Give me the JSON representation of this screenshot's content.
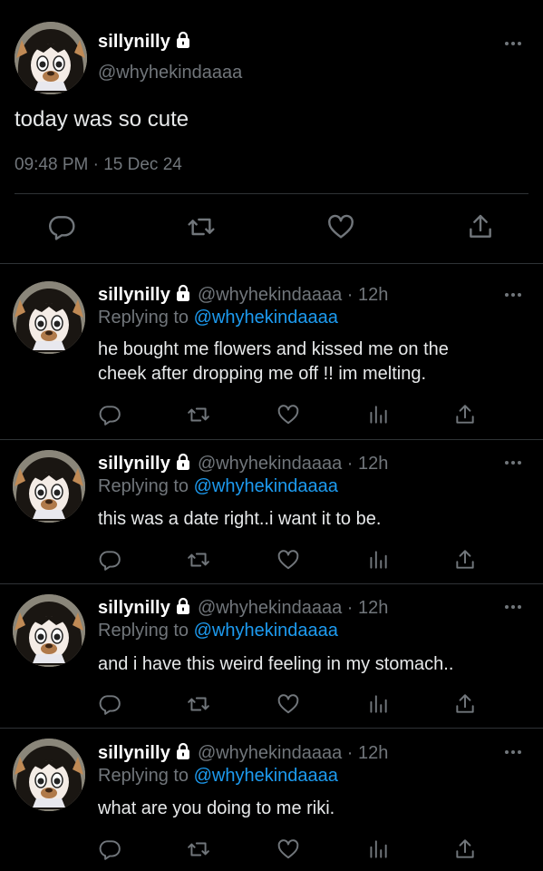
{
  "main_tweet": {
    "display_name": "sillynilly",
    "handle": "@whyhekindaaaa",
    "text": "today was so cute",
    "timestamp": "09:48 PM · 15 Dec 24",
    "protected": true,
    "actions": [
      "reply-icon",
      "retweet-icon",
      "like-icon",
      "share-icon"
    ]
  },
  "replies": [
    {
      "display_name": "sillynilly",
      "handle": "@whyhekindaaaa",
      "time": "· 12h",
      "replying_prefix": "Replying to",
      "replying_to": "@whyhekindaaaa",
      "text_lines": [
        "he bought me flowers and kissed me on the",
        "cheek after dropping me off !! im melting."
      ]
    },
    {
      "display_name": "sillynilly",
      "handle": "@whyhekindaaaa",
      "time": "· 12h",
      "replying_prefix": "Replying to",
      "replying_to": "@whyhekindaaaa",
      "text_lines": [
        "this was a date right..i want it to be."
      ]
    },
    {
      "display_name": "sillynilly",
      "handle": "@whyhekindaaaa",
      "time": "· 12h",
      "replying_prefix": "Replying to",
      "replying_to": "@whyhekindaaaa",
      "text_lines": [
        "and i have this weird feeling in my stomach.."
      ]
    },
    {
      "display_name": "sillynilly",
      "handle": "@whyhekindaaaa",
      "time": "· 12h",
      "replying_prefix": "Replying to",
      "replying_to": "@whyhekindaaaa",
      "text_lines": [
        "what are you doing to me riki."
      ]
    }
  ],
  "reply_actions": [
    "reply-icon",
    "retweet-icon",
    "like-icon",
    "analytics-icon",
    "share-icon"
  ],
  "colors": {
    "background": "#000000",
    "text": "#e7e9ea",
    "secondary": "#71767b",
    "link": "#1d9bf0",
    "divider": "#2f3336"
  }
}
